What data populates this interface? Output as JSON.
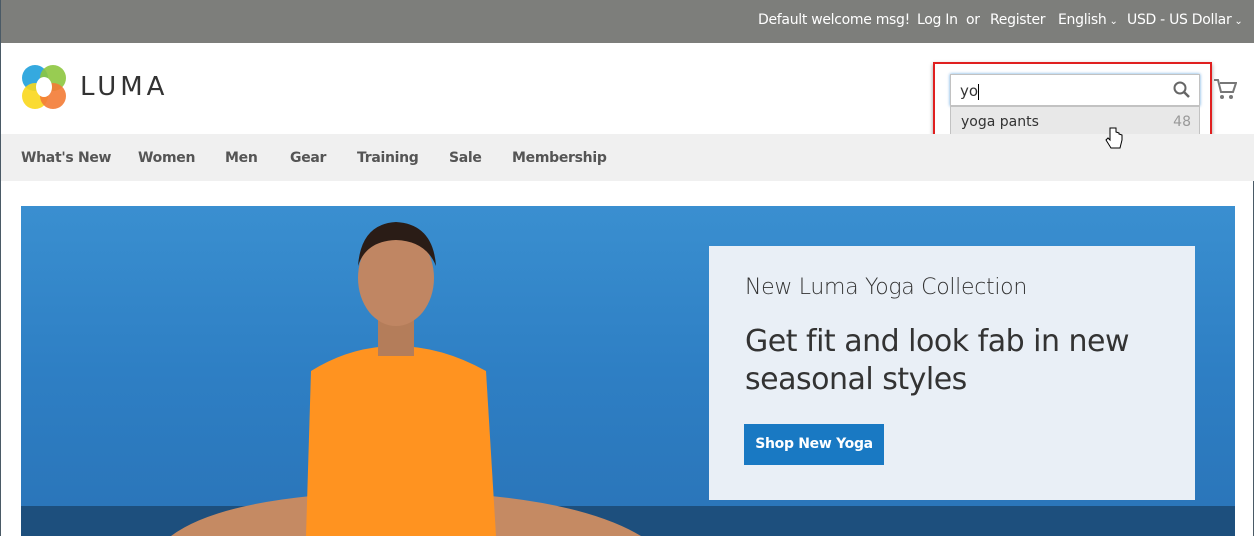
{
  "topbar": {
    "welcome": "Default welcome msg!",
    "login": "Log In",
    "or": "or",
    "register": "Register",
    "language": "English",
    "currency": "USD - US Dollar"
  },
  "header": {
    "logo_text": "LUMA",
    "search": {
      "value": "yo",
      "suggestions": [
        {
          "label": "yoga pants",
          "count": "48"
        }
      ]
    }
  },
  "nav": {
    "items": [
      "What's New",
      "Women",
      "Men",
      "Gear",
      "Training",
      "Sale",
      "Membership"
    ]
  },
  "hero": {
    "subtitle": "New Luma Yoga Collection",
    "title": "Get fit and look fab in new seasonal styles",
    "button": "Shop New Yoga"
  },
  "colors": {
    "topbar": "#7d7e7b",
    "nav": "#f0f0f0",
    "button": "#1979c3",
    "highlight": "#e02020"
  }
}
